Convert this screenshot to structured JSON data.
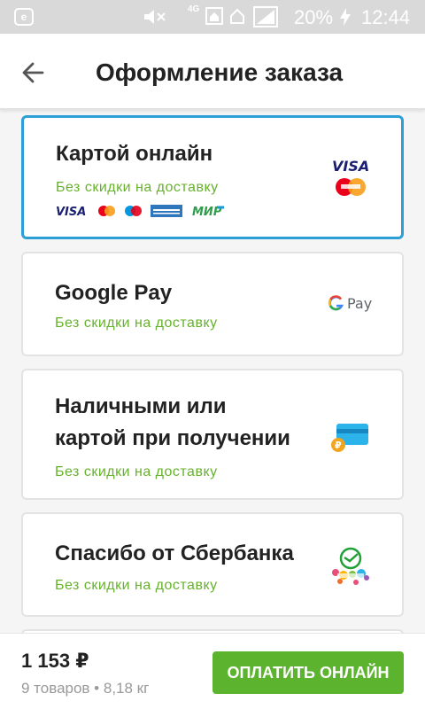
{
  "status_bar": {
    "app_letter": "e",
    "network": "4G",
    "battery": "20%",
    "time": "12:44"
  },
  "header": {
    "title": "Оформление заказа",
    "back_icon": "arrow-left-icon"
  },
  "payment_methods": [
    {
      "title": "Картой онлайн",
      "subtitle": "Без скидки на доставку",
      "selected": true,
      "logo": "visa-mastercard-logo",
      "brands": [
        "VISA",
        "MasterCard",
        "Maestro",
        "American Express",
        "МИР"
      ]
    },
    {
      "title": "Google Pay",
      "subtitle": "Без скидки на доставку",
      "selected": false,
      "logo": "google-pay-logo",
      "logo_text": "Pay"
    },
    {
      "title_line1": "Наличными или",
      "title_line2": "картой при получении",
      "subtitle": "Без скидки на доставку",
      "selected": false,
      "logo": "cash-card-icon"
    },
    {
      "title": "Спасибо от Сбербанка",
      "subtitle": "Без скидки на доставку",
      "selected": false,
      "logo": "sberbank-spasibo-logo"
    }
  ],
  "footer": {
    "total": "1 153",
    "currency": "₽",
    "items_info": "9 товаров • 8,18 кг",
    "pay_button": "ОПЛАТИТЬ ОНЛАЙН"
  },
  "colors": {
    "accent_green": "#5bb32e",
    "selected_border": "#2d9fd6",
    "subtitle_green": "#67b22c"
  }
}
